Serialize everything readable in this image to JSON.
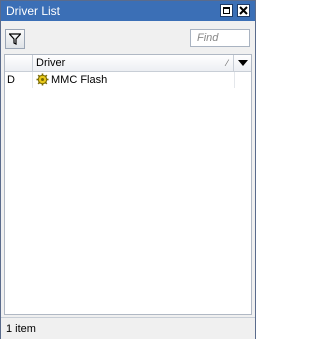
{
  "window": {
    "title": "Driver List"
  },
  "toolbar": {
    "find_placeholder": "Find"
  },
  "table": {
    "columns": [
      "",
      "Driver"
    ],
    "rows": [
      {
        "flag": "D",
        "icon": "gear-icon",
        "driver": "MMC Flash"
      }
    ]
  },
  "status": {
    "text": "1 item"
  },
  "colors": {
    "titlebar": "#3b6fb6",
    "icon": "#e8c81a"
  }
}
